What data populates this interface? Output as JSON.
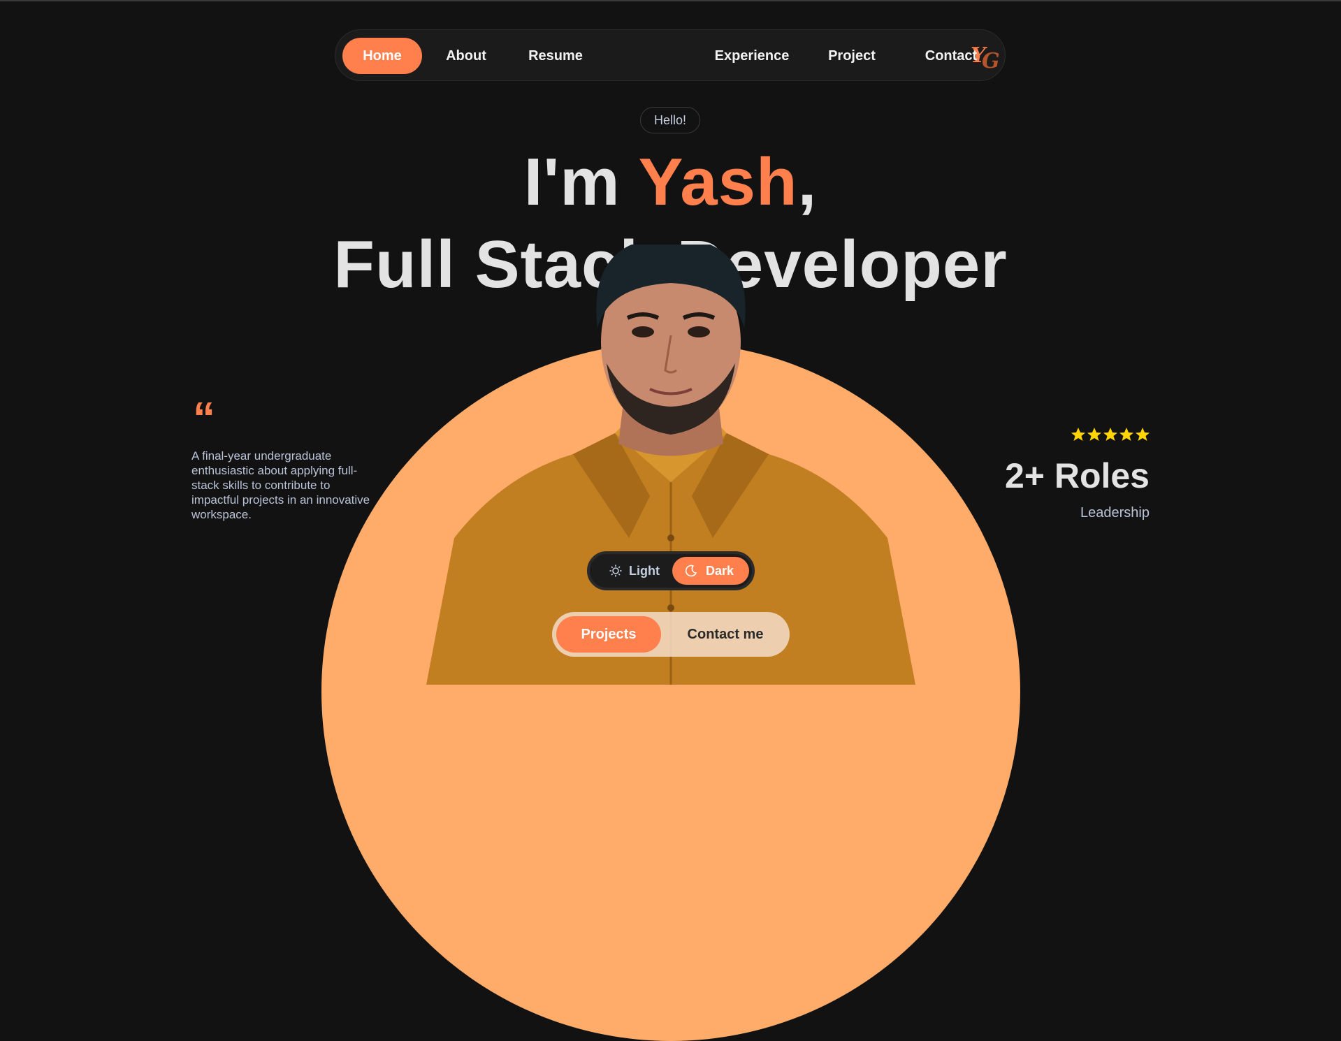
{
  "nav": {
    "items": [
      {
        "label": "Home",
        "active": true
      },
      {
        "label": "About"
      },
      {
        "label": "Resume"
      },
      {
        "label": "Experience"
      },
      {
        "label": "Project"
      },
      {
        "label": "Contact"
      }
    ],
    "logo_text": "YG"
  },
  "hero": {
    "badge": "Hello!",
    "line1_prefix": "I'm ",
    "line1_name": "Yash",
    "line1_suffix": ",",
    "line2": "Full Stack Developer"
  },
  "quote": {
    "mark": "“",
    "text": "A final-year undergraduate enthusiastic about applying full-stack skills to contribute to impactful projects in an innovative workspace."
  },
  "stats": {
    "rating": 5,
    "value": "2+ Roles",
    "label": "Leadership"
  },
  "theme_toggle": {
    "light_label": "Light",
    "dark_label": "Dark",
    "selected": "Dark"
  },
  "cta": {
    "primary_label": "Projects",
    "secondary_label": "Contact me"
  },
  "colors": {
    "accent": "#ff7f4d",
    "background": "#121212",
    "circle": "#ffac6b",
    "star": "#ffd400"
  },
  "icons": [
    "sun-icon",
    "moon-icon",
    "quote-icon",
    "star-icon",
    "logo-icon"
  ]
}
